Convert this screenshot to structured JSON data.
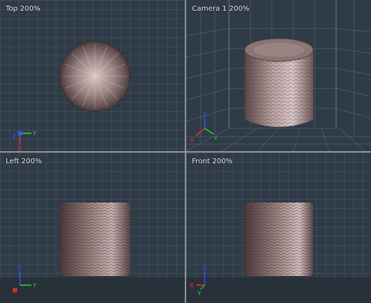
{
  "viewports": [
    {
      "id": "top",
      "label": "Top 200%",
      "active": true,
      "axes": [
        "Y",
        "Z",
        "X"
      ]
    },
    {
      "id": "camera",
      "label": "Camera 1 200%",
      "active": false,
      "axes": [
        "Z",
        "Y",
        "X"
      ]
    },
    {
      "id": "left",
      "label": "Left 200%",
      "active": false,
      "axes": [
        "Z",
        "Y"
      ]
    },
    {
      "id": "front",
      "label": "Front 200%",
      "active": false,
      "axes": [
        "Z",
        "X",
        "Y"
      ]
    }
  ],
  "colors": {
    "background": "#2f3b46",
    "grid": "#55616b",
    "grid_major": "#6b7780",
    "active_border": "#d99aa6",
    "object": "#7a6565",
    "axis_x": "#ff2a2a",
    "axis_y": "#22dd22",
    "axis_z": "#2f57ff"
  },
  "object_icon": "textured-cylinder"
}
